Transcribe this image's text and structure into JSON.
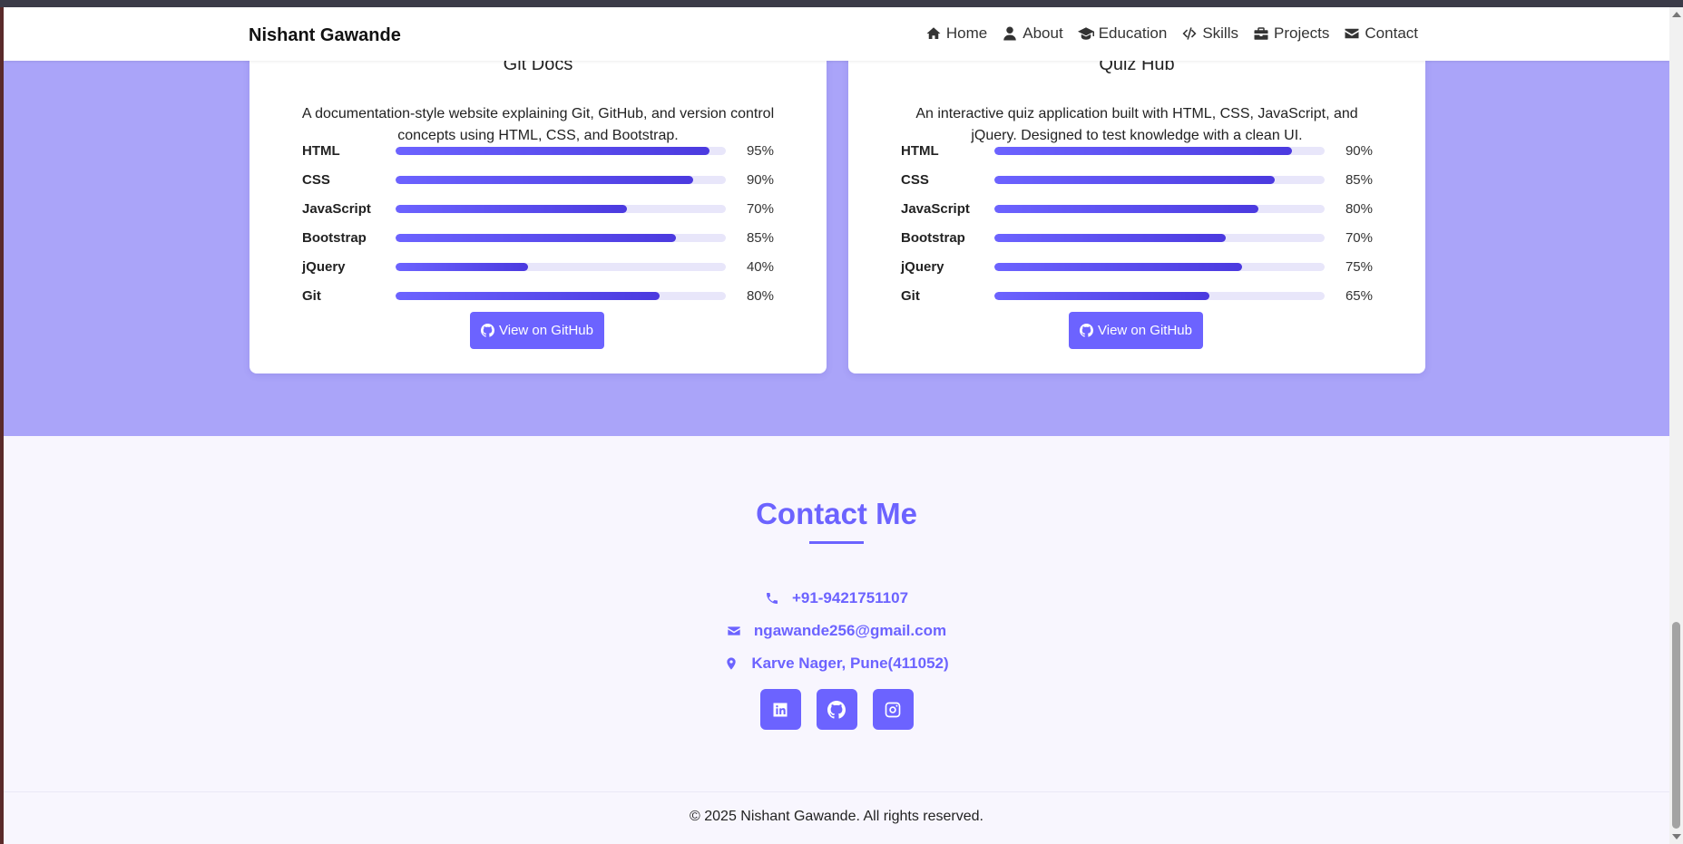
{
  "navbar": {
    "brand": "Nishant Gawande",
    "links": [
      {
        "label": "Home",
        "icon": "home-icon"
      },
      {
        "label": "About",
        "icon": "user-icon"
      },
      {
        "label": "Education",
        "icon": "graduation-cap-icon"
      },
      {
        "label": "Skills",
        "icon": "code-icon"
      },
      {
        "label": "Projects",
        "icon": "briefcase-icon"
      },
      {
        "label": "Contact",
        "icon": "envelope-icon"
      }
    ]
  },
  "projects": [
    {
      "title": "Git Docs",
      "description": "A documentation-style website explaining Git, GitHub, and version control concepts using HTML, CSS, and Bootstrap.",
      "skills": [
        {
          "name": "HTML",
          "percent": 95,
          "label": "95%"
        },
        {
          "name": "CSS",
          "percent": 90,
          "label": "90%"
        },
        {
          "name": "JavaScript",
          "percent": 70,
          "label": "70%"
        },
        {
          "name": "Bootstrap",
          "percent": 85,
          "label": "85%"
        },
        {
          "name": "jQuery",
          "percent": 40,
          "label": "40%"
        },
        {
          "name": "Git",
          "percent": 80,
          "label": "80%"
        }
      ],
      "button_label": "View on GitHub"
    },
    {
      "title": "Quiz Hub",
      "description": "An interactive quiz application built with HTML, CSS, JavaScript, and jQuery. Designed to test knowledge with a clean UI.",
      "skills": [
        {
          "name": "HTML",
          "percent": 90,
          "label": "90%"
        },
        {
          "name": "CSS",
          "percent": 85,
          "label": "85%"
        },
        {
          "name": "JavaScript",
          "percent": 80,
          "label": "80%"
        },
        {
          "name": "Bootstrap",
          "percent": 70,
          "label": "70%"
        },
        {
          "name": "jQuery",
          "percent": 75,
          "label": "75%"
        },
        {
          "name": "Git",
          "percent": 65,
          "label": "65%"
        }
      ],
      "button_label": "View on GitHub"
    }
  ],
  "contact": {
    "title": "Contact Me",
    "phone": "+91-9421751107",
    "email": "ngawande256@gmail.com",
    "address": "Karve Nager, Pune(411052)",
    "socials": [
      "linkedin-icon",
      "github-icon",
      "instagram-icon"
    ]
  },
  "footer": {
    "text": "© 2025 Nishant Gawande. All rights reserved."
  },
  "colors": {
    "accent": "#6c63ff",
    "projects_bg": "#aaa4f9",
    "contact_bg": "#f8f6fe"
  }
}
